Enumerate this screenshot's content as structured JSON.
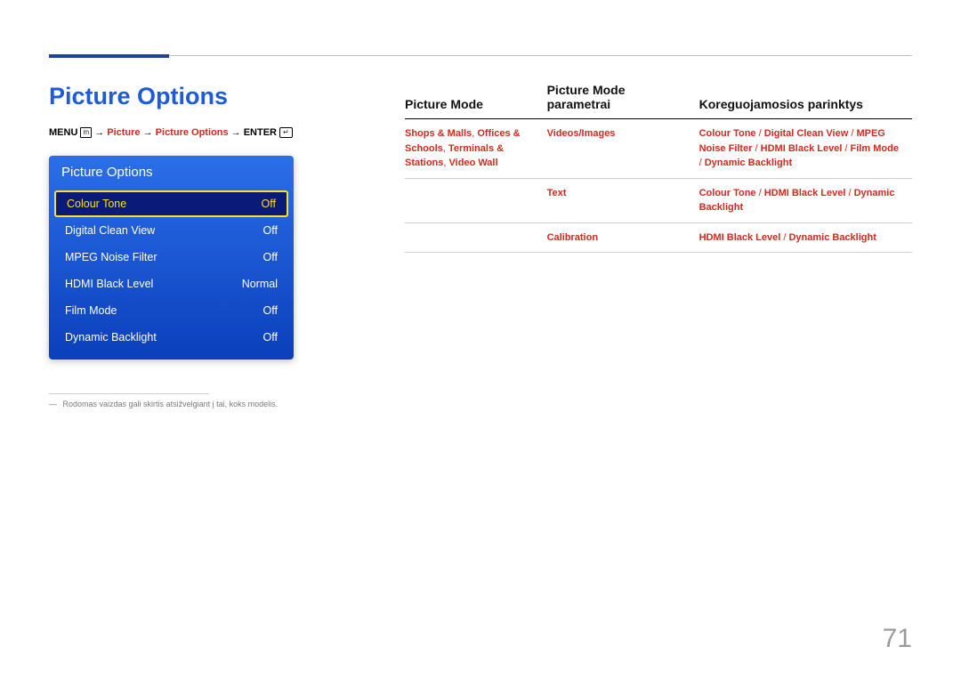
{
  "title": "Picture Options",
  "breadcrumb": {
    "menu": "MENU",
    "arrow": " → ",
    "p1": "Picture",
    "p2": "Picture Options",
    "enter": "ENTER"
  },
  "osd": {
    "header": "Picture Options",
    "rows": [
      {
        "label": "Colour Tone",
        "value": "Off",
        "selected": true
      },
      {
        "label": "Digital Clean View",
        "value": "Off",
        "selected": false
      },
      {
        "label": "MPEG Noise Filter",
        "value": "Off",
        "selected": false
      },
      {
        "label": "HDMI Black Level",
        "value": "Normal",
        "selected": false
      },
      {
        "label": "Film Mode",
        "value": "Off",
        "selected": false
      },
      {
        "label": "Dynamic Backlight",
        "value": "Off",
        "selected": false
      }
    ]
  },
  "footnote": "Rodomas vaizdas gali skirtis atsižvelgiant į tai, koks modelis.",
  "table": {
    "headers": [
      "Picture Mode",
      "Picture Mode parametrai",
      "Koreguojamosios parinktys"
    ],
    "rows": [
      {
        "mode_parts": [
          "Shops & Malls",
          ", ",
          "Offices & Schools",
          ", ",
          "Terminals & Stations",
          ", ",
          "Video Wall"
        ],
        "param": "Videos/Images",
        "opts_parts": [
          "Colour Tone",
          " / ",
          "Digital Clean View",
          " / ",
          "MPEG Noise Filter",
          " / ",
          "HDMI Black Level",
          " / ",
          "Film Mode",
          " / ",
          "Dynamic Backlight"
        ]
      },
      {
        "mode_parts": [],
        "param": "Text",
        "opts_parts": [
          "Colour Tone",
          " / ",
          "HDMI Black Level",
          " / ",
          "Dynamic Backlight"
        ]
      },
      {
        "mode_parts": [],
        "param": "Calibration",
        "opts_parts": [
          "HDMI Black Level",
          " / ",
          "Dynamic Backlight"
        ]
      }
    ]
  },
  "page_number": "71"
}
